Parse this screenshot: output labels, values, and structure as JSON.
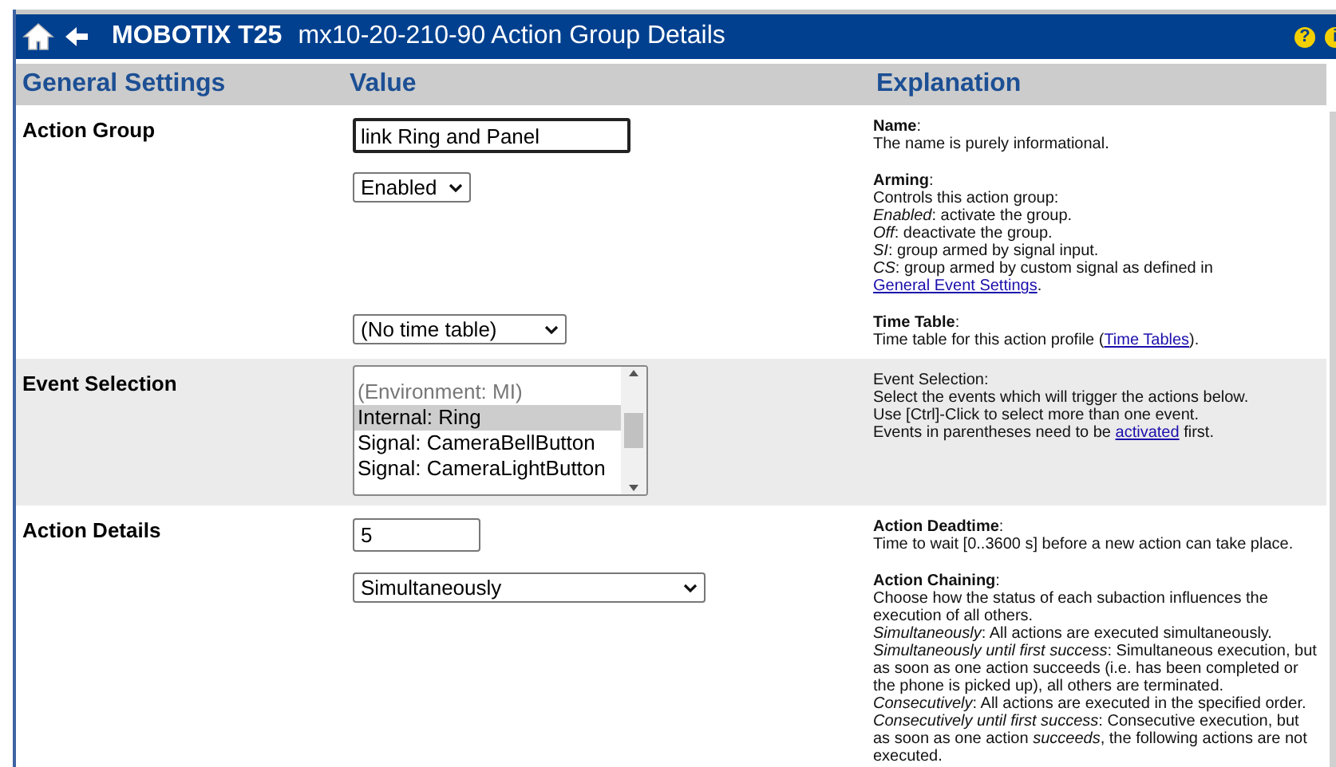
{
  "header": {
    "brand": "MOBOTIX T25",
    "title": "mx10-20-210-90 Action Group Details",
    "help_icon": "?",
    "info_icon": "i"
  },
  "columns": [
    "General Settings",
    "Value",
    "Explanation"
  ],
  "sections": [
    {
      "label": "Action Group",
      "shaded": false,
      "items": [
        {
          "kind": "text-input",
          "value": "link Ring and Panel",
          "help": {
            "title": "**Name**:",
            "lines": [
              [
                {
                  "kind": "text",
                  "text": "The name is purely informational."
                }
              ]
            ]
          }
        },
        {
          "kind": "dropdown",
          "value": "Enabled",
          "help": {
            "title": "**Arming**:",
            "lines": [
              [
                {
                  "kind": "text",
                  "text": "Controls this action group:"
                }
              ],
              [
                {
                  "kind": "text",
                  "text": "*Enabled*: activate the group."
                }
              ],
              [
                {
                  "kind": "text",
                  "text": "*Off*: deactivate the group."
                }
              ],
              [
                {
                  "kind": "text",
                  "text": "*SI*: group armed by signal input."
                }
              ],
              [
                {
                  "kind": "text",
                  "text": "*CS*: group armed by custom signal as defined in "
                },
                {
                  "kind": "link",
                  "text": "General Event Settings"
                },
                {
                  "kind": "text",
                  "text": "."
                }
              ]
            ]
          }
        },
        {
          "kind": "dropdown",
          "value": "(No time table)",
          "help": {
            "title": "**Time Table**:",
            "lines": [
              [
                {
                  "kind": "text",
                  "text": "Time table for this action profile ("
                },
                {
                  "kind": "link",
                  "text": "Time Tables"
                },
                {
                  "kind": "text",
                  "text": ")."
                }
              ]
            ]
          }
        }
      ]
    },
    {
      "label": "Event Selection",
      "shaded": true,
      "items": [
        {
          "kind": "listbox",
          "options": [
            {
              "text": "(Environment: MI)",
              "disabled": true,
              "selected": false
            },
            {
              "text": "Internal: Ring",
              "disabled": false,
              "selected": true
            },
            {
              "text": "Signal: CameraBellButton",
              "disabled": false,
              "selected": false
            },
            {
              "text": "Signal: CameraLightButton",
              "disabled": false,
              "selected": false
            }
          ],
          "help": {
            "title": "Event Selection:",
            "lines": [
              [
                {
                  "kind": "text",
                  "text": "Select the events which will trigger the actions below."
                }
              ],
              [
                {
                  "kind": "text",
                  "text": "Use [Ctrl]-Click to select more than one event."
                }
              ],
              [
                {
                  "kind": "text",
                  "text": "Events in parentheses need to be "
                },
                {
                  "kind": "link",
                  "text": "activated"
                },
                {
                  "kind": "text",
                  "text": " first."
                }
              ]
            ]
          }
        }
      ]
    },
    {
      "label": "Action Details",
      "shaded": false,
      "items": [
        {
          "kind": "short-input",
          "value": "5",
          "help": {
            "title": "**Action Deadtime**:",
            "lines": [
              [
                {
                  "kind": "text",
                  "text": "Time to wait [0..3600 s] before a new action can take place."
                }
              ]
            ]
          }
        },
        {
          "kind": "dropdown",
          "value": "Simultaneously",
          "help": {
            "title": "**Action Chaining**:",
            "lines": [
              [
                {
                  "kind": "text",
                  "text": "Choose how the status of each subaction influences the execution of all others."
                }
              ],
              [
                {
                  "kind": "text",
                  "text": "*Simultaneously*: All actions are executed simultaneously."
                }
              ],
              [
                {
                  "kind": "text",
                  "text": "*Simultaneously until first success*: Simultaneous execution, but as soon as one action succeeds (i.e. has been completed or the phone is picked up), all others are terminated."
                }
              ],
              [
                {
                  "kind": "text",
                  "text": "*Consecutively*: All actions are executed in the specified order."
                }
              ],
              [
                {
                  "kind": "text",
                  "text": "*Consecutively until first success*: Consecutive execution, but as soon as one action *succeeds*, the following actions are not executed."
                }
              ]
            ]
          }
        }
      ]
    }
  ]
}
